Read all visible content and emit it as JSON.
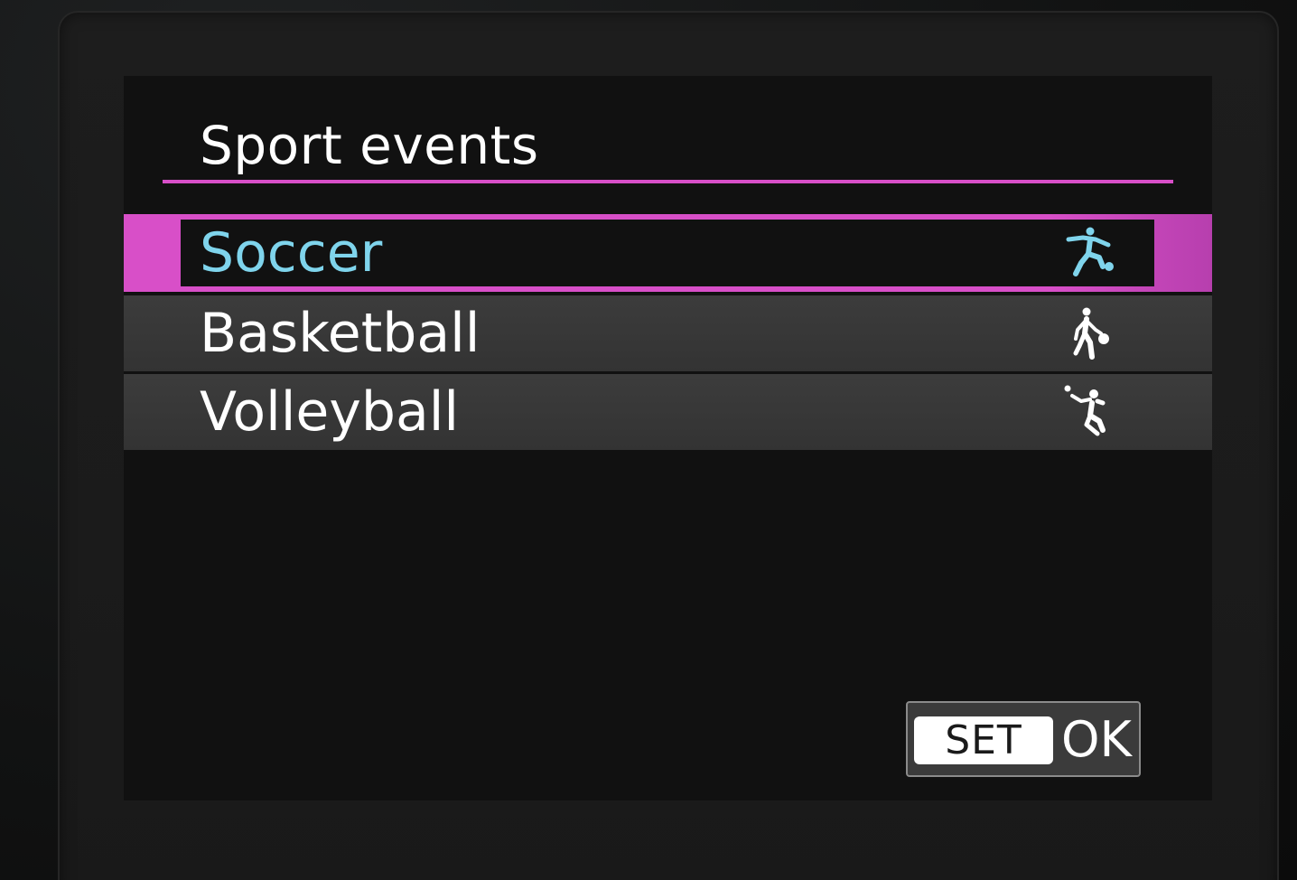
{
  "menu": {
    "title": "Sport events",
    "items": [
      {
        "label": "Soccer",
        "icon": "soccer-player-icon",
        "selected": true
      },
      {
        "label": "Basketball",
        "icon": "basketball-player-icon",
        "selected": false
      },
      {
        "label": "Volleyball",
        "icon": "volleyball-player-icon",
        "selected": false
      }
    ]
  },
  "footer": {
    "set_label": "SET",
    "ok_label": "OK"
  },
  "colors": {
    "accent": "#d84fc8",
    "selected_text": "#7fd4ec",
    "text": "#ffffff",
    "row_bg": "#363636",
    "screen_bg": "#111111"
  }
}
